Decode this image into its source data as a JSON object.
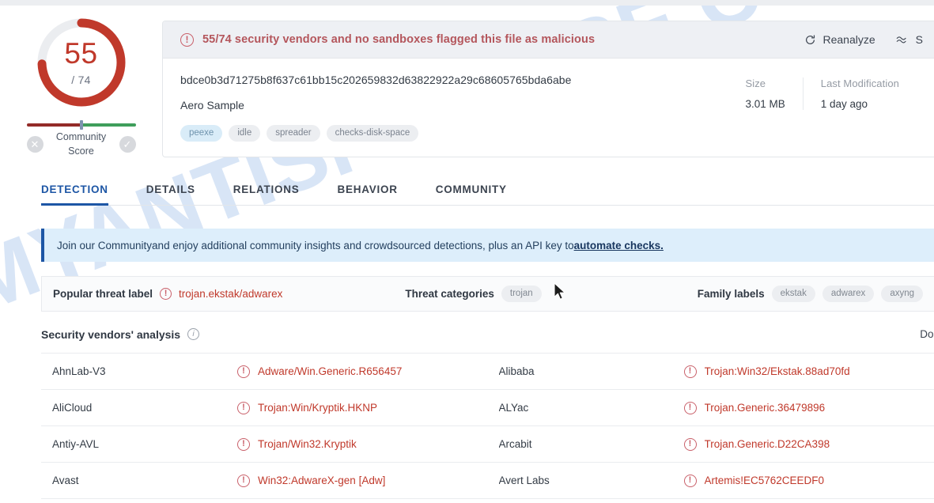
{
  "watermark": {
    "text": "MYANTISPYWARE.COM"
  },
  "gauge": {
    "score": "55",
    "total": "/ 74",
    "detected": 55,
    "max": 74,
    "arc_color": "#c0392b",
    "track_color": "#ebedf0"
  },
  "community_score": {
    "label_line1": "Community",
    "label_line2": "Score",
    "negative_icon": "close-circle-icon",
    "positive_icon": "check-circle-icon",
    "negative_glyph": "✕",
    "positive_glyph": "✓",
    "negative_color": "#932b28",
    "positive_color": "#3f9e5b"
  },
  "alert": {
    "icon": "exclamation-circle-icon",
    "glyph": "!",
    "text": "55/74 security vendors and no sandboxes flagged this file as malicious",
    "color": "#b4565c",
    "reanalyze_label": "Reanalyze",
    "similar_label": "S"
  },
  "file": {
    "hash": "bdce0b3d71275b8f637c61bb15c202659832d63822922a29c68605765bda6abe",
    "name": "Aero Sample",
    "tags": [
      {
        "label": "peexe",
        "style": "blue"
      },
      {
        "label": "idle",
        "style": "gray"
      },
      {
        "label": "spreader",
        "style": "gray"
      },
      {
        "label": "checks-disk-space",
        "style": "gray"
      }
    ],
    "meta": [
      {
        "label": "Size",
        "value": "3.01 MB"
      },
      {
        "label": "Last Modification",
        "value": "1 day ago"
      }
    ]
  },
  "tabs": [
    {
      "label": "DETECTION",
      "active": true
    },
    {
      "label": "DETAILS",
      "active": false
    },
    {
      "label": "RELATIONS",
      "active": false
    },
    {
      "label": "BEHAVIOR",
      "active": false
    },
    {
      "label": "COMMUNITY",
      "active": false
    }
  ],
  "community_banner": {
    "link1": "Join our Community",
    "middle": " and enjoy additional community insights and crowdsourced detections, plus an API key to ",
    "link2": "automate checks.",
    "accent": "#1d56a5"
  },
  "threat": {
    "popular_label": "Popular threat label",
    "popular_value": "trojan.ekstak/adwarex",
    "categories_label": "Threat categories",
    "categories": [
      "trojan"
    ],
    "family_label": "Family labels",
    "families": [
      "ekstak",
      "adwarex",
      "axyng"
    ]
  },
  "vendors": {
    "title": "Security vendors' analysis",
    "info_icon": "info-icon",
    "ask_text": "Do you wa",
    "rows": [
      {
        "left": {
          "name": "AhnLab-V3",
          "result": "Adware/Win.Generic.R656457"
        },
        "right": {
          "name": "Alibaba",
          "result": "Trojan:Win32/Ekstak.88ad70fd"
        }
      },
      {
        "left": {
          "name": "AliCloud",
          "result": "Trojan:Win/Kryptik.HKNP"
        },
        "right": {
          "name": "ALYac",
          "result": "Trojan.Generic.36479896"
        }
      },
      {
        "left": {
          "name": "Antiy-AVL",
          "result": "Trojan/Win32.Kryptik"
        },
        "right": {
          "name": "Arcabit",
          "result": "Trojan.Generic.D22CA398"
        }
      },
      {
        "left": {
          "name": "Avast",
          "result": "Win32:AdwareX-gen [Adw]"
        },
        "right": {
          "name": "Avert Labs",
          "result": "Artemis!EC5762CEEDF0"
        }
      }
    ]
  }
}
